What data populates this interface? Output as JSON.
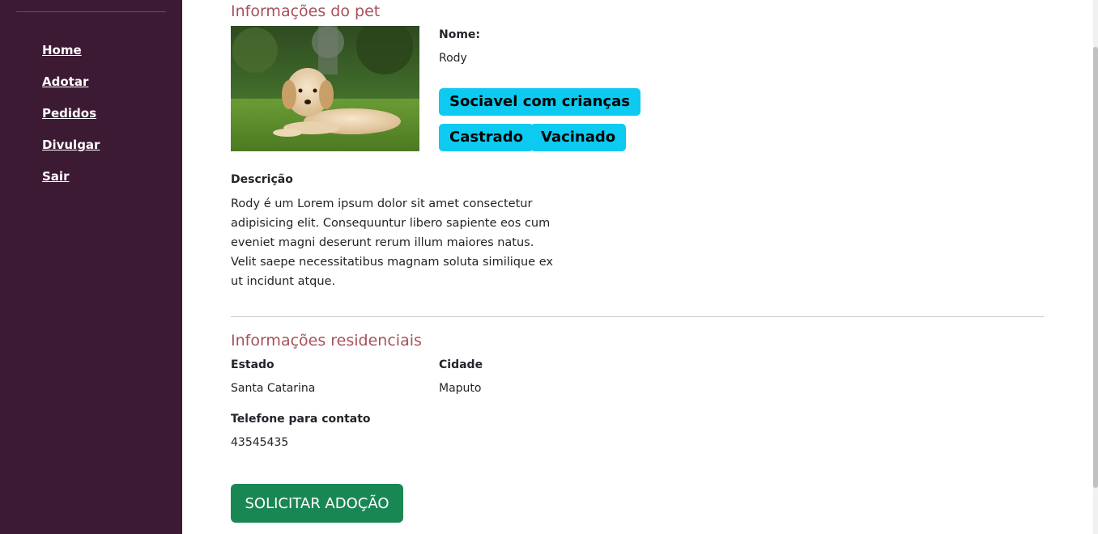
{
  "sidebar": {
    "items": [
      {
        "label": "Home"
      },
      {
        "label": "Adotar"
      },
      {
        "label": "Pedidos"
      },
      {
        "label": "Divulgar"
      },
      {
        "label": "Sair"
      }
    ]
  },
  "pet": {
    "section_title": "Informações do pet",
    "name_label": "Nome:",
    "name_value": "Rody",
    "tags": [
      "Sociavel com crianças",
      "Castrado",
      "Vacinado"
    ],
    "description_label": "Descrição",
    "description": "Rody é um Lorem ipsum dolor sit amet consectetur adipisicing elit. Consequuntur libero sapiente eos cum eveniet magni deserunt rerum illum maiores natus. Velit saepe necessitatibus magnam soluta similique ex ut incidunt atque."
  },
  "residence": {
    "section_title": "Informações residenciais",
    "state_label": "Estado",
    "state_value": "Santa Catarina",
    "city_label": "Cidade",
    "city_value": "Maputo",
    "phone_label": "Telefone para contato",
    "phone_value": "43545435"
  },
  "actions": {
    "adopt_label": "SOLICITAR ADOÇÃO"
  },
  "colors": {
    "sidebar_bg": "#3d1a33",
    "accent_title": "#a8505a",
    "badge_bg": "#0dcaf0",
    "button_bg": "#198754"
  },
  "icons": {
    "pet_photo": "puppy-photo"
  }
}
